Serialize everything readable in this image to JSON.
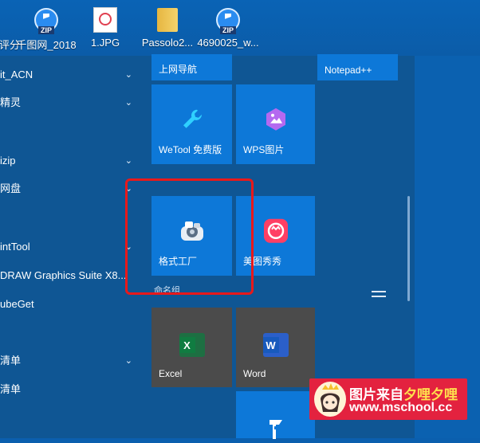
{
  "desktop_icons": [
    {
      "label": "评分",
      "icon": "zip-icon"
    },
    {
      "label": "千图网_2018",
      "icon": "zip-icon"
    },
    {
      "label": "1.JPG",
      "icon": "image-icon"
    },
    {
      "label": "Passolo2...",
      "icon": "folder-icon"
    },
    {
      "label": "4690025_w...",
      "icon": "zip-icon"
    }
  ],
  "zip_tag": "ZIP",
  "app_list": [
    {
      "label": "it_ACN"
    },
    {
      "label": "精灵"
    },
    {
      "label": "izip"
    },
    {
      "label": "网盘"
    },
    {
      "label": "intTool"
    },
    {
      "label": "DRAW Graphics Suite X8..."
    },
    {
      "label": "ubeGet"
    },
    {
      "label": "清单"
    },
    {
      "label": "清单"
    }
  ],
  "tiles": {
    "shangwang": "上网导航",
    "notepad": "Notepad++",
    "wetool": "WeTool 免费版",
    "wps": "WPS图片",
    "geshi": "格式工厂",
    "meitu": "美图秀秀",
    "group_label": "命名组",
    "excel": "Excel",
    "word": "Word",
    "excel_letter": "X",
    "word_letter": "W"
  },
  "watermark": {
    "line1_a": "图片来自",
    "line1_b": "夕哩夕哩",
    "line2": "www.mschool.cc"
  },
  "colors": {
    "accent": "#0d78d8",
    "highlight_box": "#e8191b",
    "watermark_bg": "#e3223f"
  }
}
